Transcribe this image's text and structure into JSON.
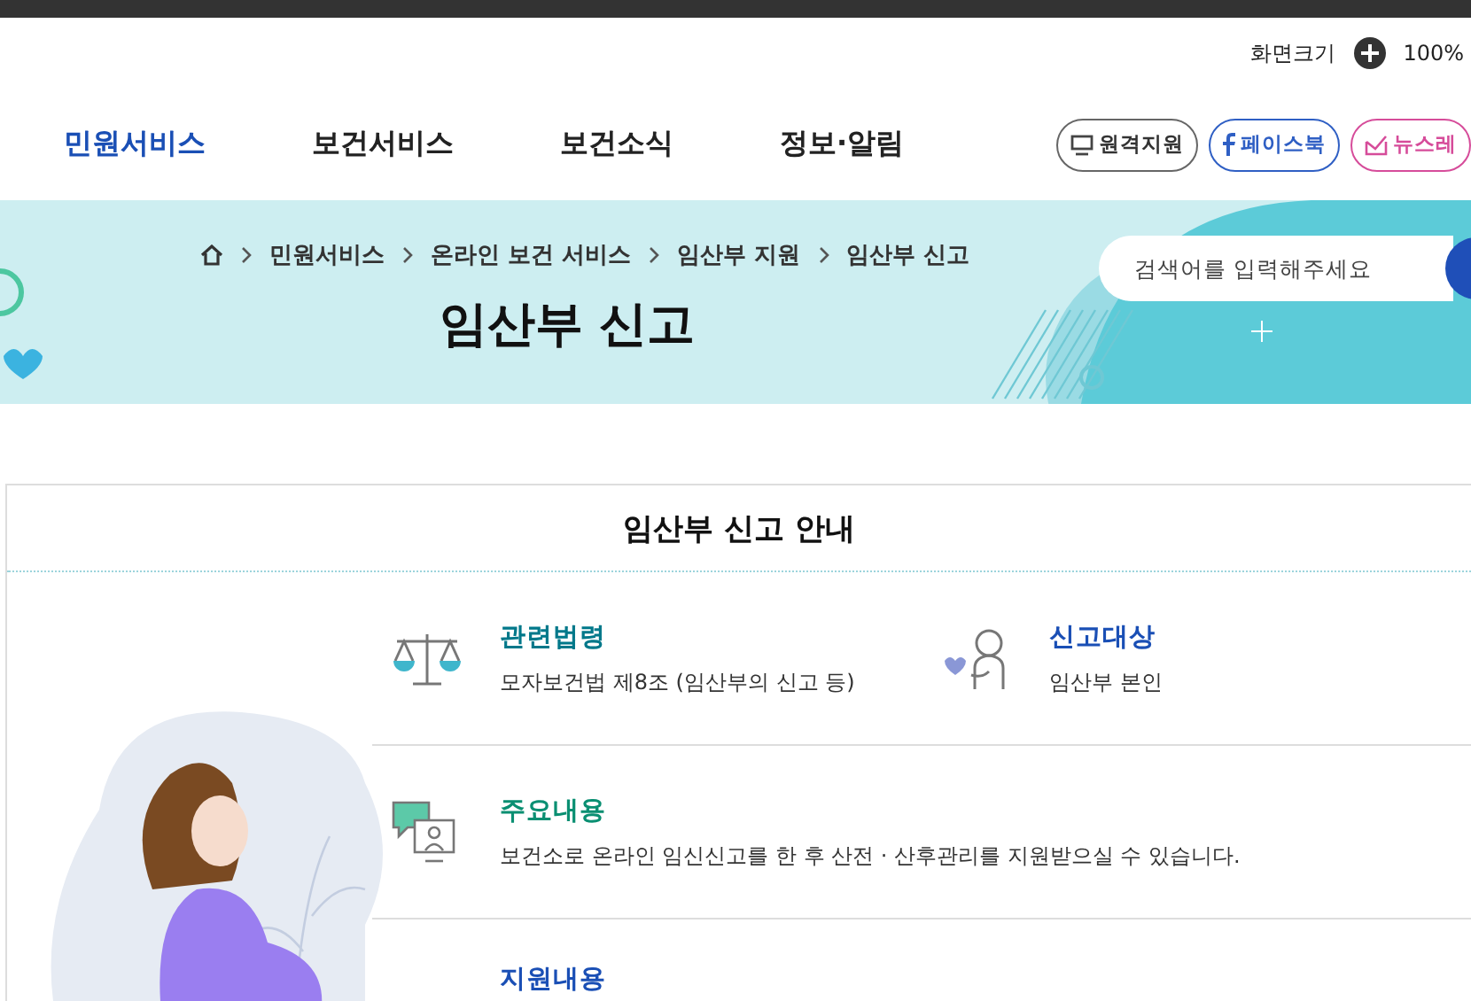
{
  "utility": {
    "label": "화면크기",
    "zoom": "100%"
  },
  "nav": {
    "items": [
      {
        "label": "민원서비스",
        "selected": true
      },
      {
        "label": "보건서비스",
        "selected": false
      },
      {
        "label": "보건소식",
        "selected": false
      },
      {
        "label": "정보·알림",
        "selected": false
      }
    ],
    "links": [
      {
        "label": "원격지원",
        "kind": "remote",
        "color": "#666666"
      },
      {
        "label": "페이스북",
        "kind": "facebook",
        "color": "#2f5fc4"
      },
      {
        "label": "뉴스레",
        "kind": "news",
        "color": "#d64c9a"
      }
    ]
  },
  "banner": {
    "breadcrumb": [
      "민원서비스",
      "온라인 보건 서비스",
      "임산부 지원",
      "임산부 신고"
    ],
    "title": "임산부 신고",
    "search": {
      "placeholder": "검색어를 입력해주세요"
    }
  },
  "guide": {
    "title": "임산부 신고 안내",
    "rows": [
      {
        "items": [
          {
            "kind": "law",
            "title": "관련법령",
            "text": "모자보건법 제8조 (임산부의 신고 등)",
            "color": "#00788a"
          },
          {
            "kind": "target",
            "title": "신고대상",
            "text": "임산부 본인",
            "color": "#1a4fb5"
          }
        ]
      },
      {
        "items": [
          {
            "kind": "content",
            "title": "주요내용",
            "text": "보건소로 온라인 임신신고를 한 후 산전 · 산후관리를 지원받으실 수 있습니다.",
            "color": "#0a8f72"
          }
        ]
      },
      {
        "items": [
          {
            "kind": "support",
            "title": "지원내용",
            "color": "#1a4fb5"
          }
        ]
      }
    ]
  }
}
